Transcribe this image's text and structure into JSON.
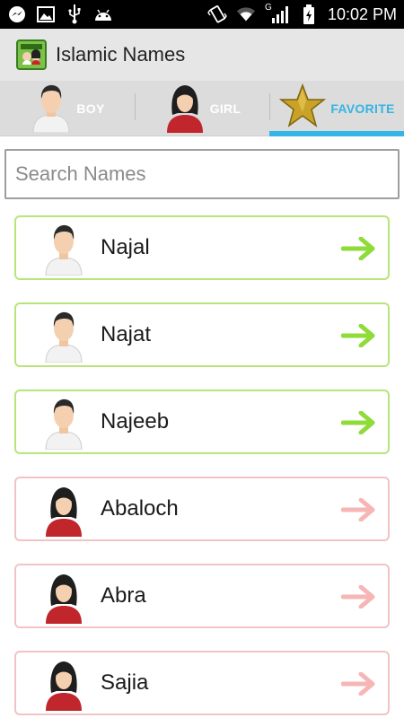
{
  "status_bar": {
    "time": "10:02 PM",
    "network_label": "G"
  },
  "action_bar": {
    "title": "Islamic Names",
    "app_icon": "islamic-names-app-icon"
  },
  "tabs": [
    {
      "label": "BOY",
      "icon": "boy-avatar-icon",
      "active": false
    },
    {
      "label": "GIRL",
      "icon": "girl-avatar-icon",
      "active": false
    },
    {
      "label": "FAVORITE",
      "icon": "star-icon",
      "active": true
    }
  ],
  "search": {
    "placeholder": "Search Names",
    "value": ""
  },
  "names": [
    {
      "name": "Najal",
      "gender": "boy"
    },
    {
      "name": "Najat",
      "gender": "boy"
    },
    {
      "name": "Najeeb",
      "gender": "boy"
    },
    {
      "name": "Abaloch",
      "gender": "girl"
    },
    {
      "name": "Abra",
      "gender": "girl"
    },
    {
      "name": "Sajia",
      "gender": "girl"
    }
  ],
  "colors": {
    "accent": "#33b5e5",
    "boy_border": "#b7e57a",
    "girl_border": "#f2c3c3",
    "boy_arrow": "#8fdb3a",
    "girl_arrow": "#f7b6b6"
  }
}
